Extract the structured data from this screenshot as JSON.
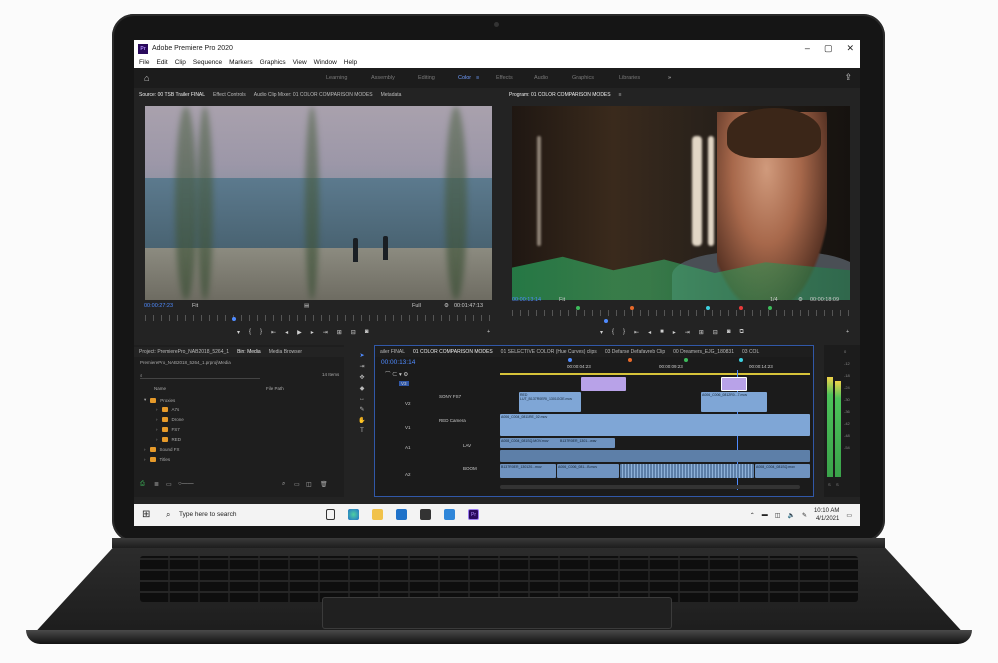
{
  "window": {
    "title": "Adobe Premiere Pro 2020",
    "logo": "Pr"
  },
  "menu": [
    "File",
    "Edit",
    "Clip",
    "Sequence",
    "Markers",
    "Graphics",
    "View",
    "Window",
    "Help"
  ],
  "workspaces": [
    "Learning",
    "Assembly",
    "Editing",
    "Color",
    "Effects",
    "Audio",
    "Graphics",
    "Libraries"
  ],
  "active_workspace": "Color",
  "source_tabs": [
    "Source: 00 TSB Trailer FINAL",
    "Effect Controls",
    "Audio Clip Mixer: 01 COLOR COMPARISON MODES",
    "Metadata"
  ],
  "program_tab": "Program: 01 COLOR COMPARISON MODES",
  "source": {
    "timecode": "00:00:27:23",
    "fit": "Fit",
    "quality": "Full",
    "duration": "00:01:47:13"
  },
  "program": {
    "timecode": "00:00:13:14",
    "fit": "Fit",
    "quality": "1/4",
    "duration": "00:00:18:09"
  },
  "project_tabs": [
    "Project: PremierePro_NAB2018_5264_1",
    "Bin: Media",
    "Media Browser"
  ],
  "project_path": "PremierePro_NAB2018_5264_1.prproj\\Media",
  "item_count": "14 Items",
  "columns": {
    "name": "Name",
    "path": "File Path"
  },
  "bins": [
    "Proxies",
    "A7s",
    "Drone",
    "FS7",
    "RED",
    "Sound FX",
    "Titles"
  ],
  "timeline_tabs": [
    "ailer FINAL",
    "01 COLOR COMPARISON MODES",
    "01 SELECTIVE COLOR (Hue Curves) clips",
    "03 Defarse Defafavreb Clip",
    "00 Dreamers_EJG_180831",
    "03 COL"
  ],
  "timeline_timecode": "00:00:13:14",
  "ruler_times": [
    "00:00:04:23",
    "00:00:09:23",
    "00:00:14:23"
  ],
  "tracks": {
    "v3": "V3",
    "v2": "V2",
    "v1": "V1",
    "a1": "A1",
    "a2": "A2",
    "v3_name": "SONY FS7",
    "v1_name": "RED Camera",
    "a1_name": "LAV",
    "a2_name": "BOOM"
  },
  "clips": {
    "red_lut": "RED LUT_B137R0ERI_1301GOE.mov",
    "a006": "A006_C006_0812R0...7.mov",
    "red_camera": "A006_C004_0811RE_02.mov",
    "a008": "A008_C004_081SQ.MOV.mov",
    "aud1": "B137R0ER_1301...wav",
    "aud2": "A006_C006_0812R3.mov",
    "audb1": "B137R0ER_130120...mov",
    "audb2": "A006_C006_081...B.mov",
    "audb3": "A008_C004_081SQ.mov"
  },
  "meter_scale": [
    "0",
    "-12",
    "-18",
    "-24",
    "-30",
    "-36",
    "-42",
    "-48",
    "-54"
  ],
  "meter_labels": [
    "S",
    "S"
  ],
  "taskbar": {
    "search": "Type here to search",
    "time": "10:10 AM",
    "date": "4/1/2021"
  },
  "colors": {
    "accent": "#4f8bff",
    "premiere": "#2a0a5c",
    "folder": "#e69a2a",
    "clip_video": "#7fa6d6",
    "clip_purple": "#b8a2e8",
    "meter_green": "#3aa24a"
  }
}
